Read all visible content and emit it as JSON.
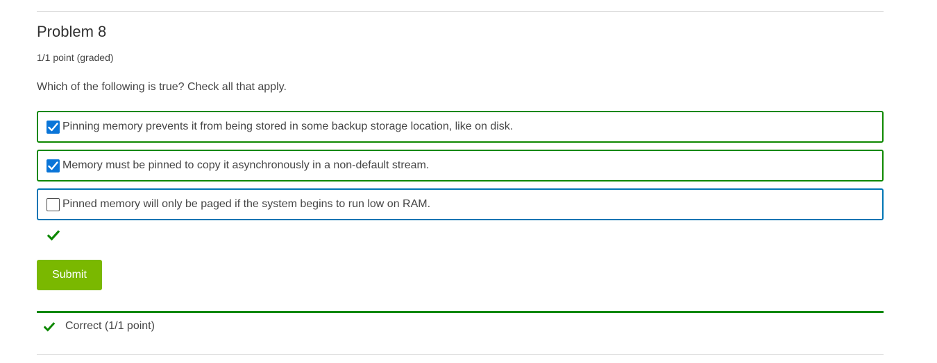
{
  "problem": {
    "title": "Problem 8",
    "points": "1/1 point (graded)",
    "question": "Which of the following is true? Check all that apply."
  },
  "choices": [
    {
      "label": "Pinning memory prevents it from being stored in some backup storage location, like on disk.",
      "checked": true
    },
    {
      "label": "Memory must be pinned to copy it asynchronously in a non-default stream.",
      "checked": true
    },
    {
      "label": "Pinned memory will only be paged if the system begins to run low on RAM.",
      "checked": false
    }
  ],
  "submit": {
    "label": "Submit"
  },
  "status": {
    "text": "Correct (1/1 point)"
  },
  "icons": {
    "correct": "checkmark-icon",
    "checkbox": "checkbox-checked-icon"
  },
  "colors": {
    "correct_green": "#0d8800",
    "submit_green": "#7ab800",
    "checkbox_blue": "#0a75d8",
    "focus_blue": "#0075b4"
  }
}
